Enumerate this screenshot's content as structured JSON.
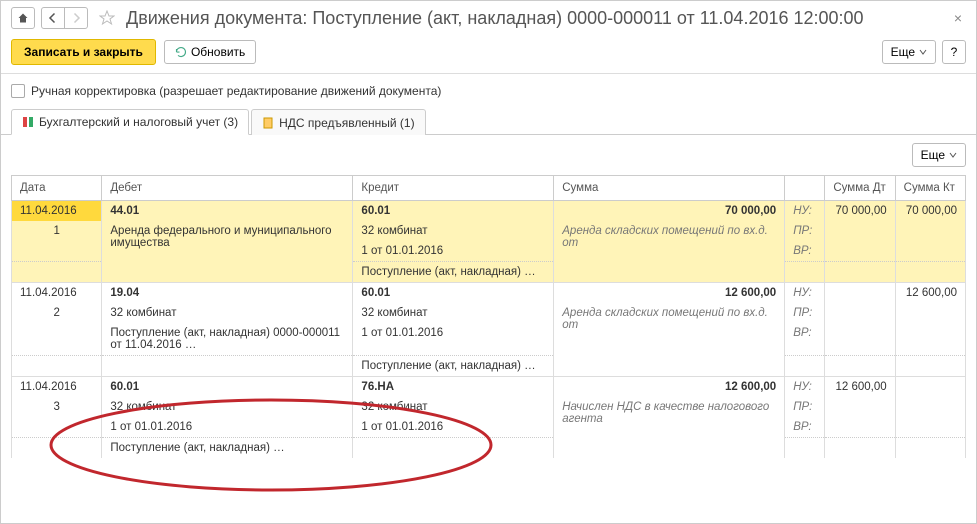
{
  "header": {
    "title": "Движения документа: Поступление (акт, накладная) 0000-000011 от 11.04.2016 12:00:00"
  },
  "toolbar": {
    "save_close": "Записать и закрыть",
    "refresh": "Обновить",
    "more": "Еще",
    "help": "?"
  },
  "manual_edit_label": "Ручная корректировка (разрешает редактирование движений документа)",
  "tabs": [
    {
      "label": "Бухгалтерский и налоговый учет (3)"
    },
    {
      "label": "НДС предъявленный (1)"
    }
  ],
  "table": {
    "headers": {
      "date": "Дата",
      "debit": "Дебет",
      "credit": "Кредит",
      "sum": "Сумма",
      "sum_dt": "Сумма Дт",
      "sum_kt": "Сумма Кт"
    },
    "labels": {
      "nu": "НУ:",
      "pr": "ПР:",
      "vr": "ВР:"
    },
    "rows": [
      {
        "date": "11.04.2016",
        "n": "1",
        "dt_acc": "44.01",
        "dt_l1": "Аренда федерального и муниципального имущества",
        "kr_acc": "60.01",
        "kr_l1": "32 комбинат",
        "kr_l2": "1 от 01.01.2016",
        "kr_l3": "Поступление (акт, накладная) …",
        "desc": "Аренда складских помещений по вх.д.  от",
        "sum": "70 000,00",
        "sum_dt": "70 000,00",
        "sum_kt": "70 000,00"
      },
      {
        "date": "11.04.2016",
        "n": "2",
        "dt_acc": "19.04",
        "dt_l1": "32 комбинат",
        "dt_l2": "Поступление (акт, накладная) 0000-000011 от 11.04.2016 …",
        "kr_acc": "60.01",
        "kr_l1": "32 комбинат",
        "kr_l2": "1 от 01.01.2016",
        "kr_l3": "Поступление (акт, накладная) …",
        "desc": "Аренда складских помещений по вх.д.  от",
        "sum": "12 600,00",
        "sum_kt": "12 600,00"
      },
      {
        "date": "11.04.2016",
        "n": "3",
        "dt_acc": "60.01",
        "dt_l1": "32 комбинат",
        "dt_l2": "1 от 01.01.2016",
        "dt_l3": "Поступление (акт, накладная) …",
        "kr_acc": "76.НА",
        "kr_l1": "32 комбинат",
        "kr_l2": "1 от 01.01.2016",
        "desc": "Начислен НДС в качестве налогового агента",
        "sum": "12 600,00",
        "sum_dt": "12 600,00"
      }
    ]
  }
}
